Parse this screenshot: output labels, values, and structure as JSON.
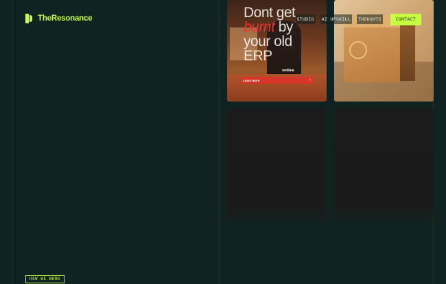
{
  "brand": {
    "name": "TheResonance"
  },
  "nav": {
    "links": [
      "STUDIO",
      "AI UPSKILL",
      "THOUGHTS"
    ],
    "contact_label": "CONTACT"
  },
  "ad": {
    "line1": "Dont get",
    "line2_accent": "burnt",
    "line2_rest": " by",
    "line3": "your old",
    "line4": "ERP",
    "cta": "Learn More",
    "brand": "ondlaia"
  },
  "section_tag": "HOW WE WORK",
  "colors": {
    "background": "#102320",
    "accent": "#c6ff41",
    "card_dark": "#1b1b1b",
    "ad_red": "#d9342a"
  },
  "icons": [
    "logo-mark-icon",
    "arrow-right-icon"
  ]
}
